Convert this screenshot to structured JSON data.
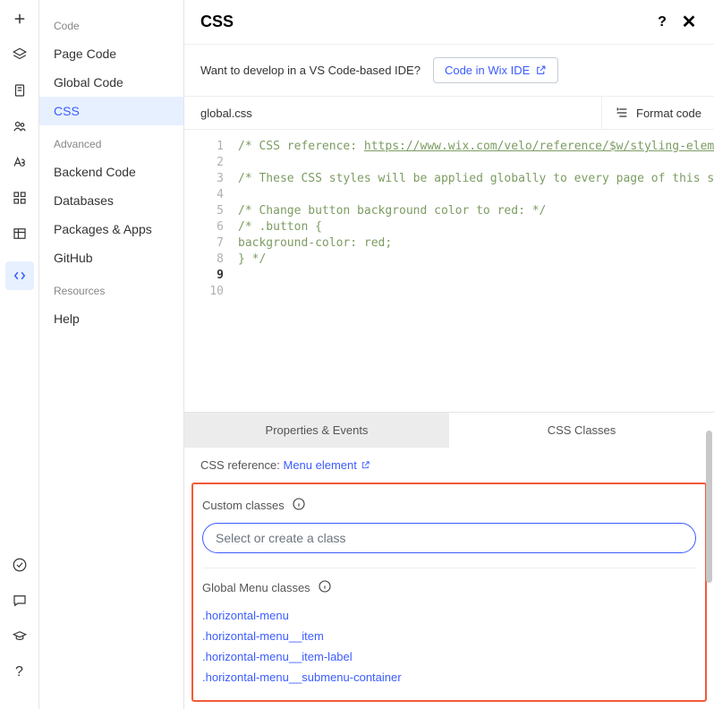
{
  "header": {
    "title": "CSS"
  },
  "sidebar": {
    "sections": [
      {
        "label": "Code",
        "items": [
          {
            "label": "Page Code",
            "active": false
          },
          {
            "label": "Global Code",
            "active": false
          },
          {
            "label": "CSS",
            "active": true
          }
        ]
      },
      {
        "label": "Advanced",
        "items": [
          {
            "label": "Backend Code"
          },
          {
            "label": "Databases"
          },
          {
            "label": "Packages & Apps"
          },
          {
            "label": "GitHub"
          }
        ]
      },
      {
        "label": "Resources",
        "items": [
          {
            "label": "Help"
          }
        ]
      }
    ]
  },
  "ide_banner": {
    "text": "Want to develop in a VS Code-based IDE?",
    "button": "Code in Wix IDE"
  },
  "file_bar": {
    "filename": "global.css",
    "format_label": "Format code"
  },
  "code": {
    "lines": [
      "/* CSS reference: https://www.wix.com/velo/reference/$w/styling-elem",
      "",
      "/* These CSS styles will be applied globally to every page of this s",
      "",
      "/*  Change button background color to red: */",
      "/* .button {",
      "    background-color: red;",
      "} */",
      "",
      ""
    ],
    "current_line": 9
  },
  "panel": {
    "tab_inactive": "Properties & Events",
    "tab_active": "CSS Classes",
    "cssref_label": "CSS reference:",
    "cssref_link": "Menu element",
    "custom_classes_label": "Custom classes",
    "class_input_placeholder": "Select or create a class",
    "global_classes_label": "Global Menu classes",
    "global_classes": [
      ".horizontal-menu",
      ".horizontal-menu__item",
      ".horizontal-menu__item-label",
      ".horizontal-menu__submenu-container"
    ]
  }
}
